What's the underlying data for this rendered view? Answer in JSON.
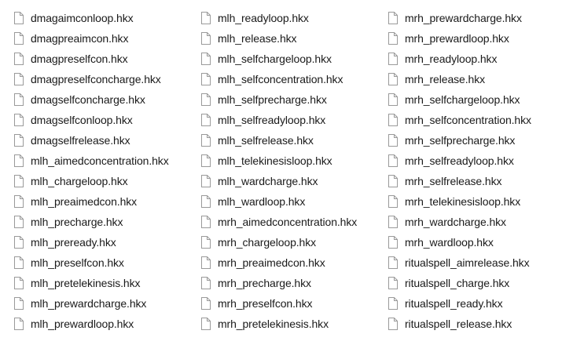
{
  "columns": [
    {
      "files": [
        "dmagaimconloop.hkx",
        "dmagpreaimcon.hkx",
        "dmagpreselfcon.hkx",
        "dmagpreselfconcharge.hkx",
        "dmagselfconcharge.hkx",
        "dmagselfconloop.hkx",
        "dmagselfrelease.hkx",
        "mlh_aimedconcentration.hkx",
        "mlh_chargeloop.hkx",
        "mlh_preaimedcon.hkx",
        "mlh_precharge.hkx",
        "mlh_preready.hkx",
        "mlh_preselfcon.hkx",
        "mlh_pretelekinesis.hkx",
        "mlh_prewardcharge.hkx",
        "mlh_prewardloop.hkx"
      ]
    },
    {
      "files": [
        "mlh_readyloop.hkx",
        "mlh_release.hkx",
        "mlh_selfchargeloop.hkx",
        "mlh_selfconcentration.hkx",
        "mlh_selfprecharge.hkx",
        "mlh_selfreadyloop.hkx",
        "mlh_selfrelease.hkx",
        "mlh_telekinesisloop.hkx",
        "mlh_wardcharge.hkx",
        "mlh_wardloop.hkx",
        "mrh_aimedconcentration.hkx",
        "mrh_chargeloop.hkx",
        "mrh_preaimedcon.hkx",
        "mrh_precharge.hkx",
        "mrh_preselfcon.hkx",
        "mrh_pretelekinesis.hkx"
      ]
    },
    {
      "files": [
        "mrh_prewardcharge.hkx",
        "mrh_prewardloop.hkx",
        "mrh_readyloop.hkx",
        "mrh_release.hkx",
        "mrh_selfchargeloop.hkx",
        "mrh_selfconcentration.hkx",
        "mrh_selfprecharge.hkx",
        "mrh_selfreadyloop.hkx",
        "mrh_selfrelease.hkx",
        "mrh_telekinesisloop.hkx",
        "mrh_wardcharge.hkx",
        "mrh_wardloop.hkx",
        "ritualspell_aimrelease.hkx",
        "ritualspell_charge.hkx",
        "ritualspell_ready.hkx",
        "ritualspell_release.hkx"
      ]
    }
  ],
  "file_icon": "generic-file-icon",
  "colors": {
    "background": "#ffffff",
    "text": "#1a1a1a",
    "icon_border": "#9a9a9a",
    "icon_fill": "#ffffff"
  }
}
